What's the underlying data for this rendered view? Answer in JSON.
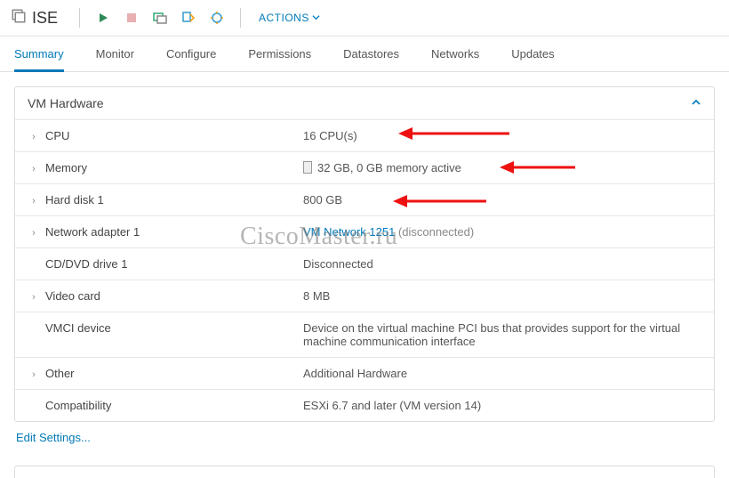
{
  "header": {
    "vm_name": "ISE",
    "actions_label": "ACTIONS"
  },
  "tabs": [
    {
      "label": "Summary",
      "active": true
    },
    {
      "label": "Monitor",
      "active": false
    },
    {
      "label": "Configure",
      "active": false
    },
    {
      "label": "Permissions",
      "active": false
    },
    {
      "label": "Datastores",
      "active": false
    },
    {
      "label": "Networks",
      "active": false
    },
    {
      "label": "Updates",
      "active": false
    }
  ],
  "panel": {
    "title": "VM Hardware",
    "edit_link": "Edit Settings..."
  },
  "rows": {
    "cpu": {
      "label": "CPU",
      "value": "16 CPU(s)",
      "expandable": true
    },
    "memory": {
      "label": "Memory",
      "value": "32 GB, 0 GB memory active",
      "expandable": true
    },
    "disk": {
      "label": "Hard disk 1",
      "value": "800 GB",
      "expandable": true
    },
    "nic": {
      "label": "Network adapter 1",
      "link": "VM Network 1251",
      "suffix": " (disconnected)",
      "expandable": true
    },
    "cddvd": {
      "label": "CD/DVD drive 1",
      "value": "Disconnected",
      "expandable": false
    },
    "video": {
      "label": "Video card",
      "value": "8 MB",
      "expandable": true
    },
    "vmci": {
      "label": "VMCI device",
      "value": "Device on the virtual machine PCI bus that provides support for the virtual machine communication interface",
      "expandable": false
    },
    "other": {
      "label": "Other",
      "value": "Additional Hardware",
      "expandable": true
    },
    "compat": {
      "label": "Compatibility",
      "value": "ESXi 6.7 and later (VM version 14)",
      "expandable": false
    }
  },
  "watermark": "CiscoMaster.ru"
}
